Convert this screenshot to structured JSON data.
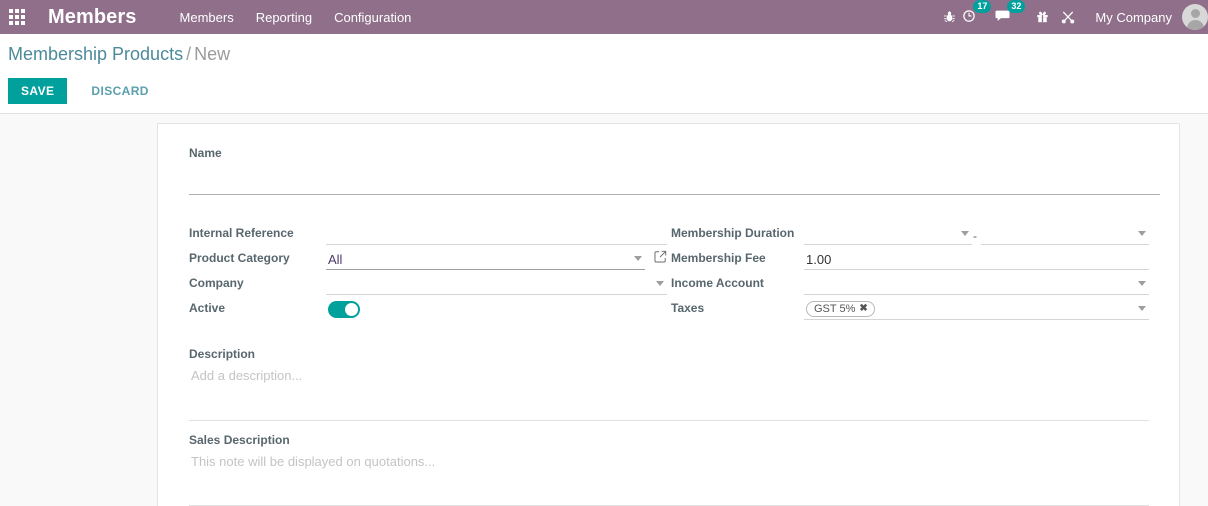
{
  "navbar": {
    "apps_icon": "apps-grid-icon",
    "brand": "Members",
    "menu": [
      {
        "label": "Members"
      },
      {
        "label": "Reporting"
      },
      {
        "label": "Configuration"
      }
    ],
    "systray": {
      "bug_icon": "bug-icon",
      "activity_icon": "clock-activity-icon",
      "activity_count": "17",
      "messages_icon": "chat-messages-icon",
      "messages_count": "32",
      "gift_icon": "gift-icon",
      "shortcut_icon": "scissors-icon",
      "company": "My Company",
      "avatar_icon": "user-avatar-icon"
    },
    "colors": {
      "navbar_bg": "#8f6f8a",
      "badge_bg": "#00a09d"
    }
  },
  "control_panel": {
    "breadcrumb": {
      "parent": "Membership Products",
      "separator": "/",
      "current": "New"
    },
    "save_label": "SAVE",
    "discard_label": "DISCARD",
    "colors": {
      "save_bg": "#00a09d",
      "discard_fg": "#5aa0ad"
    }
  },
  "form": {
    "name": {
      "label": "Name",
      "value": "",
      "placeholder": ""
    },
    "left_fields": [
      {
        "label": "Internal Reference",
        "value": "",
        "type": "text"
      },
      {
        "label": "Product Category",
        "value": "All",
        "type": "select"
      },
      {
        "label": "Company",
        "value": "",
        "type": "select"
      },
      {
        "label": "Active",
        "value": "on",
        "type": "toggle"
      }
    ],
    "right_fields": [
      {
        "label": "Membership Duration",
        "value_from": "",
        "value_to": "",
        "separator": "-",
        "type": "date-range"
      },
      {
        "label": "Membership Fee",
        "value": "1.00",
        "type": "number"
      },
      {
        "label": "Income Account",
        "value": "",
        "type": "select"
      },
      {
        "label": "Taxes",
        "value": "",
        "type": "tags",
        "tags": [
          {
            "label": "GST 5%",
            "remove": "✖"
          }
        ]
      }
    ],
    "description": {
      "label": "Description",
      "placeholder": "Add a description..."
    },
    "sales_description": {
      "label": "Sales Description",
      "placeholder": "This note will be displayed on quotations..."
    }
  }
}
